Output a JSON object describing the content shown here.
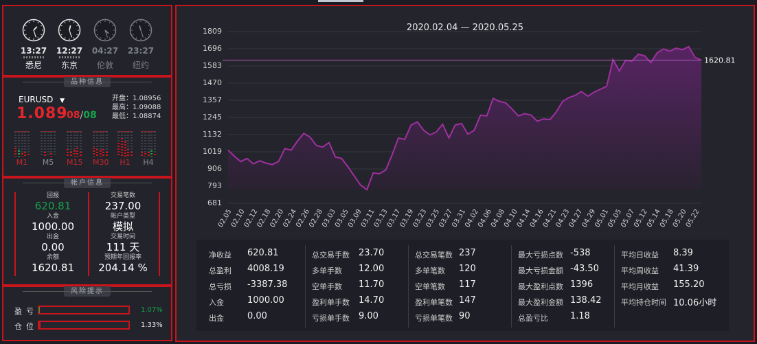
{
  "colors": {
    "frame": "#c8141c",
    "up": "#17a34a",
    "down": "#e3262b",
    "line": "#a030a0",
    "area": "#4a1f55"
  },
  "clocks": [
    {
      "time": "13:27",
      "city": "悉尼",
      "hour": 13,
      "minute": 27,
      "active": true
    },
    {
      "time": "12:27",
      "city": "东京",
      "hour": 12,
      "minute": 27,
      "active": true
    },
    {
      "time": "04:27",
      "city": "伦敦",
      "hour": 4,
      "minute": 27,
      "active": false
    },
    {
      "time": "23:27",
      "city": "纽约",
      "hour": 23,
      "minute": 27,
      "active": false
    }
  ],
  "instrument": {
    "title": "品种信息",
    "symbol": "EURUSD",
    "dropdown_icon": "caret-down-icon",
    "price_main": "1.089",
    "price_frac_a": "08",
    "price_sep": "/",
    "price_frac_b": "08",
    "open": "开盘：1.08956",
    "high": "最高：1.09088",
    "low": "最低：1.08874",
    "timeframes": [
      {
        "label": "M1",
        "active": true,
        "levels": [
          0.35,
          0.25,
          0.15,
          0.2,
          0.1
        ],
        "green": [
          false,
          true,
          false,
          false,
          false
        ]
      },
      {
        "label": "M5",
        "active": false,
        "levels": [
          0,
          0.2,
          0,
          0.15,
          0
        ],
        "green": [
          false,
          false,
          false,
          false,
          false
        ]
      },
      {
        "label": "M15",
        "active": true,
        "levels": [
          0.3,
          0.2,
          0.25,
          0.35,
          0.2
        ],
        "green": [
          false,
          false,
          false,
          false,
          false
        ]
      },
      {
        "label": "M30",
        "active": true,
        "levels": [
          0.35,
          0.3,
          0.25,
          0.3,
          0.2
        ],
        "green": [
          false,
          false,
          false,
          false,
          false
        ]
      },
      {
        "label": "H1",
        "active": true,
        "levels": [
          0.55,
          0.75,
          0.6,
          0.3,
          0.2
        ],
        "green": [
          false,
          false,
          false,
          false,
          false
        ]
      },
      {
        "label": "H4",
        "active": false,
        "levels": [
          0.2,
          0.15,
          0.2,
          0.25,
          0.1
        ],
        "green": [
          false,
          false,
          false,
          true,
          false
        ]
      }
    ]
  },
  "account": {
    "title": "帐户信息",
    "fields": [
      {
        "key": "回报",
        "value": "620.81",
        "color": "#17a34a"
      },
      {
        "key": "交易笔数",
        "value": "237.00",
        "color": "#ffffff"
      },
      {
        "key": "入金",
        "value": "1000.00",
        "color": "#ffffff"
      },
      {
        "key": "帐户类型",
        "value": "模拟",
        "color": "#ffffff"
      },
      {
        "key": "出金",
        "value": "0.00",
        "color": "#ffffff"
      },
      {
        "key": "交易时间",
        "value": "111 天",
        "color": "#ffffff"
      },
      {
        "key": "余额",
        "value": "1620.81",
        "color": "#ffffff"
      },
      {
        "key": "预期年回报率",
        "value": "204.14 %",
        "color": "#ffffff"
      }
    ]
  },
  "risk": {
    "title": "风险提示",
    "rows": [
      {
        "label": "盈亏",
        "value": "1.07%",
        "color": "#17a34a",
        "fraction": 0.0107
      },
      {
        "label": "仓位",
        "value": "1.33%",
        "color": "#e6e6e6",
        "fraction": 0.0133
      }
    ]
  },
  "chart_data": {
    "type": "area",
    "title": "2020.02.04 — 2020.05.25",
    "yticks": [
      "1809",
      "1696",
      "1583",
      "1470",
      "1357",
      "1245",
      "1132",
      "1019",
      "906",
      "793",
      "681"
    ],
    "ylim": [
      681,
      1809
    ],
    "xticks": [
      "02.05",
      "02.10",
      "02.12",
      "02.18",
      "02.20",
      "02.24",
      "02.26",
      "02.28",
      "03.03",
      "03.05",
      "03.09",
      "03.11",
      "03.13",
      "03.17",
      "03.19",
      "03.23",
      "03.25",
      "03.27",
      "03.31",
      "04.02",
      "04.06",
      "04.08",
      "04.10",
      "04.14",
      "04.16",
      "04.21",
      "04.23",
      "04.27",
      "04.29",
      "05.01",
      "05.05",
      "05.07",
      "05.12",
      "05.14",
      "05.18",
      "05.20",
      "05.22"
    ],
    "last_value_label": "1620.81",
    "last_value": 1620.81,
    "values": [
      1030,
      990,
      955,
      975,
      940,
      960,
      945,
      935,
      955,
      1040,
      1030,
      1090,
      1140,
      1115,
      1060,
      1050,
      1080,
      985,
      975,
      920,
      860,
      800,
      770,
      880,
      875,
      900,
      1000,
      1110,
      1100,
      1195,
      1215,
      1160,
      1130,
      1150,
      1200,
      1110,
      1195,
      1205,
      1135,
      1160,
      1260,
      1255,
      1370,
      1350,
      1340,
      1300,
      1255,
      1270,
      1260,
      1220,
      1235,
      1230,
      1280,
      1350,
      1375,
      1390,
      1415,
      1385,
      1410,
      1430,
      1450,
      1625,
      1550,
      1620,
      1615,
      1660,
      1650,
      1605,
      1670,
      1695,
      1680,
      1700,
      1690,
      1710,
      1640,
      1620.81
    ]
  },
  "stats": {
    "columns": [
      [
        {
          "k": "净收益",
          "v": "620.81"
        },
        {
          "k": "总盈利",
          "v": "4008.19"
        },
        {
          "k": "总亏损",
          "v": "-3387.38"
        },
        {
          "k": "入金",
          "v": "1000.00"
        },
        {
          "k": "出金",
          "v": "0.00"
        }
      ],
      [
        {
          "k": "总交易手数",
          "v": "23.70"
        },
        {
          "k": "多单手数",
          "v": "12.00"
        },
        {
          "k": "空单手数",
          "v": "11.70"
        },
        {
          "k": "盈利单手数",
          "v": "14.70"
        },
        {
          "k": "亏损单手数",
          "v": "9.00"
        }
      ],
      [
        {
          "k": "总交易笔数",
          "v": "237"
        },
        {
          "k": "多单笔数",
          "v": "120"
        },
        {
          "k": "空单笔数",
          "v": "117"
        },
        {
          "k": "盈利单笔数",
          "v": "147"
        },
        {
          "k": "亏损单笔数",
          "v": "90"
        }
      ],
      [
        {
          "k": "最大亏损点数",
          "v": "-538"
        },
        {
          "k": "最大亏损金额",
          "v": "-43.50"
        },
        {
          "k": "最大盈利点数",
          "v": "1396"
        },
        {
          "k": "最大盈利金额",
          "v": "138.42"
        },
        {
          "k": "总盈亏比",
          "v": "1.18"
        }
      ],
      [
        {
          "k": "平均日收益",
          "v": "8.39"
        },
        {
          "k": "平均周收益",
          "v": "41.39"
        },
        {
          "k": "平均月收益",
          "v": "155.20"
        },
        {
          "k": "平均持仓时间",
          "v": "10.06小时"
        }
      ]
    ]
  }
}
